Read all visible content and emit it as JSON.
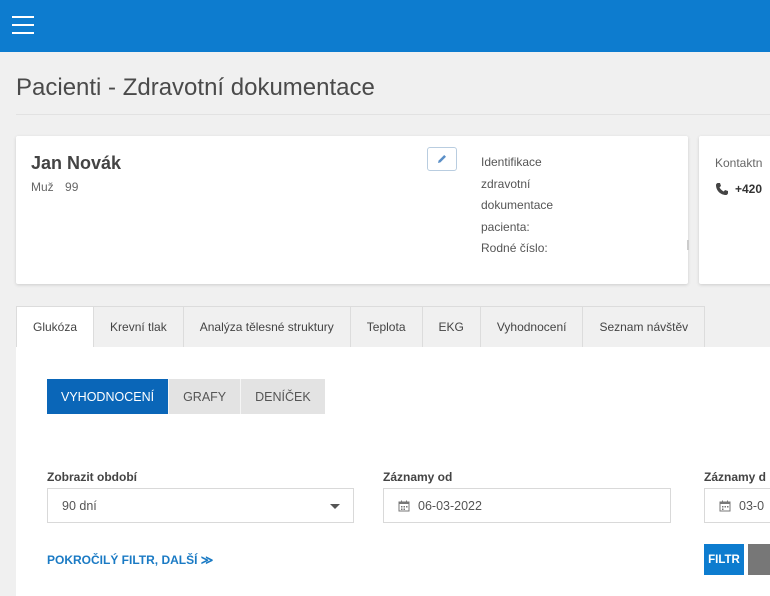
{
  "header": {
    "menu_icon": "hamburger-menu-icon",
    "bar_color": "#0d7ccf"
  },
  "page": {
    "title": "Pacienti - Zdravotní dokumentace"
  },
  "patient": {
    "name": "Jan Novák",
    "sex": "Muž",
    "age": "99",
    "edit_icon": "pencil-icon",
    "id_label_lines": [
      "Identifikace",
      "zdravotní",
      "dokumentace",
      "pacienta:",
      "Rodné číslo:"
    ]
  },
  "contact": {
    "label": "Kontaktn",
    "phone_icon": "phone-icon",
    "phone": "+420"
  },
  "tabs": [
    {
      "label": "Glukóza",
      "active": true
    },
    {
      "label": "Krevní tlak",
      "active": false
    },
    {
      "label": "Analýza tělesné struktury",
      "active": false
    },
    {
      "label": "Teplota",
      "active": false
    },
    {
      "label": "EKG",
      "active": false
    },
    {
      "label": "Vyhodnocení",
      "active": false
    },
    {
      "label": "Seznam návštěv",
      "active": false
    }
  ],
  "view_toggle": [
    {
      "label": "VYHODNOCENÍ",
      "active": true
    },
    {
      "label": "GRAFY",
      "active": false
    },
    {
      "label": "DENÍČEK",
      "active": false
    }
  ],
  "filters": {
    "period": {
      "label": "Zobrazit období",
      "value": "90 dní"
    },
    "records_from": {
      "label": "Záznamy od",
      "value": "06-03-2022"
    },
    "records_to": {
      "label": "Záznamy d",
      "value": "03-0"
    }
  },
  "advanced_link": "POKROČILÝ FILTR, DALŠÍ ≫",
  "filter_button": "FILTR",
  "accent_color": "#0a66b8"
}
